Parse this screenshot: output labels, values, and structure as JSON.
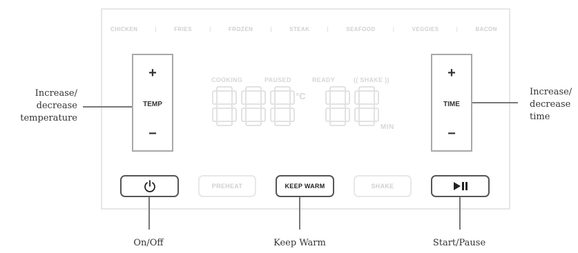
{
  "presets": [
    "CHICKEN",
    "FRIES",
    "FROZEN",
    "STEAK",
    "SEAFOOD",
    "VEGGIES",
    "BACON"
  ],
  "presets_separator": "|",
  "temp_control": {
    "plus": "+",
    "label": "TEMP",
    "minus": "−"
  },
  "time_control": {
    "plus": "+",
    "label": "TIME",
    "minus": "−"
  },
  "status": {
    "cooking": "COOKING",
    "paused": "PAUSED",
    "ready": "READY",
    "shake": "(( SHAKE ))"
  },
  "display": {
    "temp_digits": "888",
    "temp_unit": "°C",
    "time_digits": "88",
    "time_unit": "MIN"
  },
  "buttons": {
    "power_icon": "power-icon",
    "preheat": "PREHEAT",
    "keep_warm": "KEEP WARM",
    "shake": "SHAKE",
    "play_pause_icon": "play-pause-icon"
  },
  "callouts": {
    "increase_temp": [
      "Increase/",
      "decrease",
      "temperature"
    ],
    "increase_time": [
      "Increase/",
      "decrease",
      "time"
    ],
    "on_off": "On/Off",
    "keep_warm": "Keep Warm",
    "start_pause": "Start/Pause"
  }
}
